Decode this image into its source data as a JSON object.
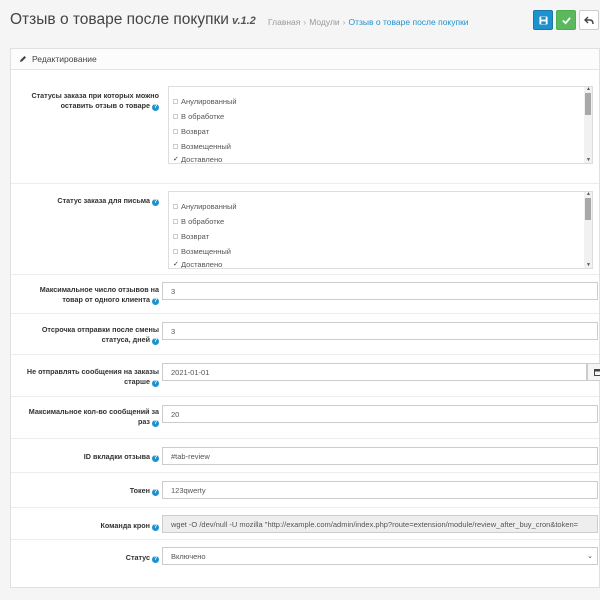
{
  "header": {
    "title": "Отзыв о товаре после покупки",
    "version": "v.1.2",
    "breadcrumb": [
      "Главная",
      "Модули",
      "Отзыв о товаре после покупки"
    ],
    "sep": "›"
  },
  "icons": {
    "save": "save-icon",
    "ok": "check-icon",
    "back": "reply-icon",
    "pencil": "pencil-icon",
    "calendar": "calendar-icon"
  },
  "colors": {
    "primary": "#1e91cf",
    "success": "#5cb85c"
  },
  "panel": {
    "heading": "Редактирование"
  },
  "form": {
    "review_statuses": {
      "label": "Статусы заказа при которых можно оставить отзыв о товаре",
      "options": [
        {
          "label": "Анулированный",
          "checked": false
        },
        {
          "label": "В обработке",
          "checked": false
        },
        {
          "label": "Возврат",
          "checked": false
        },
        {
          "label": "Возмещенный",
          "checked": false
        },
        {
          "label": "Доставлено",
          "checked": true
        }
      ]
    },
    "mail_status": {
      "label": "Статус заказа для письма",
      "options": [
        {
          "label": "Анулированный",
          "checked": false
        },
        {
          "label": "В обработке",
          "checked": false
        },
        {
          "label": "Возврат",
          "checked": false
        },
        {
          "label": "Возмещенный",
          "checked": false
        },
        {
          "label": "Доставлено",
          "checked": true
        }
      ]
    },
    "max_reviews": {
      "label": "Максимальное число отзывов на товар от одного клиента",
      "value": "3"
    },
    "delay": {
      "label": "Отсрочка отправки после смены статуса, дней",
      "value": "3"
    },
    "older": {
      "label": "Не отправлять сообщения на заказы старше",
      "value": "2021-01-01"
    },
    "max_msgs": {
      "label": "Максимальное кол-во сообщений за раз",
      "value": "20"
    },
    "tab_id": {
      "label": "ID вкладки отзыва",
      "value": "#tab-review"
    },
    "token": {
      "label": "Токен",
      "value": "123qwerty"
    },
    "cron": {
      "label": "Команда крон",
      "value": "wget -O /dev/null -U mozilla \"http://example.com/admin/index.php?route=extension/module/review_after_buy_cron&token="
    },
    "status": {
      "label": "Статус",
      "value": "Включено"
    }
  }
}
